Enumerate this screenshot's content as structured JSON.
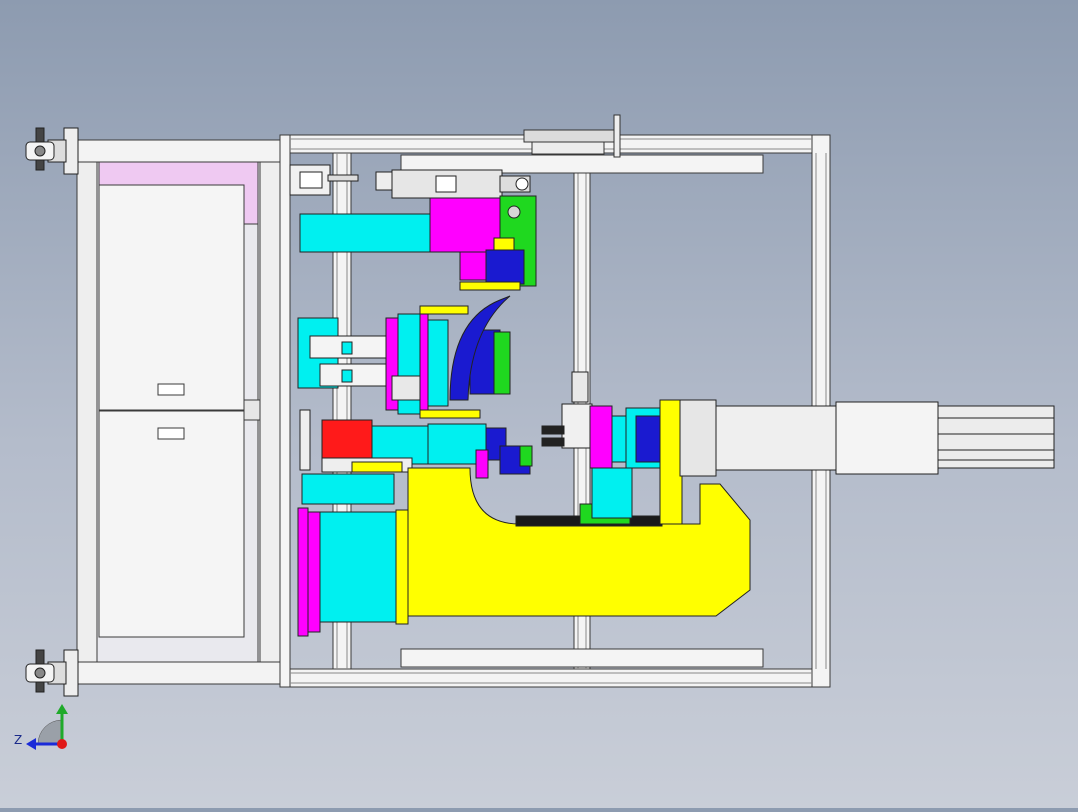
{
  "viewport": {
    "background_top": "#8d9bb0",
    "background_bottom": "#c9ced8"
  },
  "triad": {
    "axes": [
      "Y",
      "Z"
    ],
    "label_z": "Z",
    "colors": {
      "y": "#1faa2a",
      "z": "#1a2ad8",
      "origin": "#e01818"
    }
  },
  "palette": {
    "frame": "#f2f2f2",
    "frame_line": "#3a3a3a",
    "cabinet_panel": "#eceaf0",
    "pink_panel": "#efc9f2",
    "magenta": "#ff00ff",
    "cyan": "#00f0f0",
    "yellow": "#ffff00",
    "green": "#1fd81f",
    "blue": "#1a1ad0",
    "red": "#ff1a1a",
    "grey_part": "#c8c8c8"
  }
}
